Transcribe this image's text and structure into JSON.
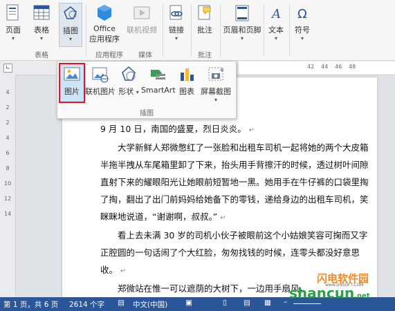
{
  "ribbon": {
    "page_label": "页面",
    "table_label": "表格",
    "illustration_label": "插图",
    "office_apps_line1": "Office",
    "office_apps_line2": "应用程序",
    "online_video_label": "联机视频",
    "link_label": "链接",
    "comment_label": "批注",
    "header_footer_label": "页眉和页脚",
    "text_label": "文本",
    "symbol_label": "符号",
    "group_table": "表格",
    "group_apps": "应用程序",
    "group_media": "媒体",
    "group_comment": "批注"
  },
  "ruler": {
    "top_ticks": [
      "42",
      "44",
      "46",
      "48"
    ],
    "left_ticks": [
      "4",
      "2",
      "2",
      "4",
      "6",
      "8",
      "10",
      "12",
      "14"
    ]
  },
  "illustration_menu": {
    "picture": "图片",
    "online_picture": "联机图片",
    "shapes": "形状",
    "smartart": "SmartArt",
    "chart": "图表",
    "screenshot": "屏幕截图",
    "group_label": "插图"
  },
  "document": {
    "paragraphs": [
      "9 月 10 日，南国的盛夏，烈日炎炎。",
      "大学新鲜人郑微憋红了一张脸和出租车司机一起将她的两个大皮箱半拖半拽从车尾箱里卸了下来，抬头用手背擦汗的时候，透过树叶间隙直射下来的耀眼阳光让她眼前短暂地一黑。她用手在牛仔裤的口袋里掏了掏，翻出了出门前妈妈给她备下的零钱，递给身边的出租车司机，笑眯眯地说道，“谢谢啊，叔叔。”",
      "看上去未满 30 岁的司机小伙子被眼前这个小姑娘笑容可掬而又字正腔圆的一句话闹了个大红脸，匆匆找钱的时候，连零头都没好意思收。",
      "郑微站在惟一可以遮荫的大树下，一边用手扇风，"
    ]
  },
  "status": {
    "page": "第 1 页，共 6 页",
    "words": "2614 个字",
    "language": "中文(中国)"
  },
  "watermark": {
    "brand": "闪电软件园",
    "site": "shancun",
    "suffix": ".net",
    "url": "www.D9SOFT.COM"
  },
  "colors": {
    "accent": "#2b579a",
    "highlight": "#e81123"
  }
}
